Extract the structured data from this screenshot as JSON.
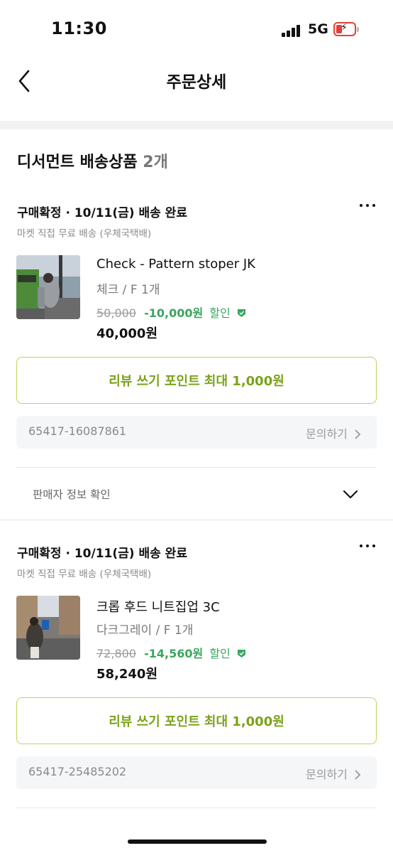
{
  "status_bar": {
    "time": "11:30",
    "network": "5G"
  },
  "header": {
    "title": "주문상세"
  },
  "section": {
    "title": "디서먼트 배송상품",
    "count": "2개"
  },
  "orders": [
    {
      "status": "구매확정 · 10/11(금) 배송 완료",
      "shipping": "마켓 직접 무료 배송 (우체국택배)",
      "product_name": "Check - Pattern stoper JK",
      "option": "체크 / F  1개",
      "original_price": "50,000",
      "discount": "-10,000원",
      "discount_label": "할인",
      "final_price": "40,000원",
      "review_button": "리뷰 쓰기 포인트 최대 1,000원",
      "order_number": "65417-16087861",
      "inquiry": "문의하기"
    },
    {
      "status": "구매확정 · 10/11(금) 배송 완료",
      "shipping": "마켓 직접 무료 배송 (우체국택배)",
      "product_name": "크롭 후드 니트집업 3C",
      "option": "다크그레이 / F  1개",
      "original_price": "72,800",
      "discount": "-14,560원",
      "discount_label": "할인",
      "final_price": "58,240원",
      "review_button": "리뷰 쓰기 포인트 최대 1,000원",
      "order_number": "65417-25485202",
      "inquiry": "문의하기"
    }
  ],
  "seller_info": {
    "label": "판매자 정보 확인"
  },
  "colors": {
    "accent_green": "#3aa55f",
    "review_border": "#b9d65c",
    "review_text": "#7aa21a",
    "battery": "#e0413a"
  }
}
